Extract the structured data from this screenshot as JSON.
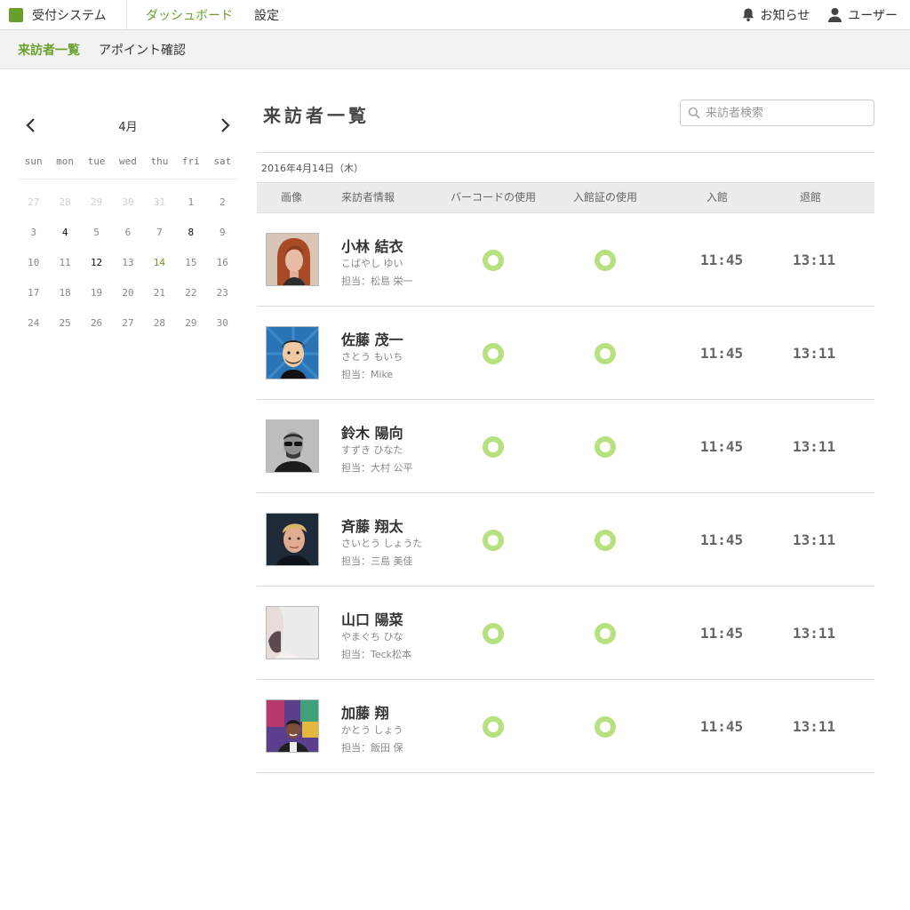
{
  "app": {
    "name": "受付システム",
    "brand_color": "#6a9f2c",
    "nav": [
      "ダッシュボード",
      "設定"
    ],
    "notifications_label": "お知らせ",
    "user_label": "ユーザー"
  },
  "subnav": [
    "来訪者一覧",
    "アポイント確認"
  ],
  "calendar": {
    "month": "4月",
    "weekdays": [
      "sun",
      "mon",
      "tue",
      "wed",
      "thu",
      "fri",
      "sat"
    ],
    "weeks": [
      [
        "27",
        "28",
        "29",
        "30",
        "31",
        "1",
        "2"
      ],
      [
        "3",
        "4",
        "5",
        "6",
        "7",
        "8",
        "9"
      ],
      [
        "10",
        "11",
        "12",
        "13",
        "14",
        "15",
        "16"
      ],
      [
        "17",
        "18",
        "19",
        "20",
        "21",
        "22",
        "23"
      ],
      [
        "24",
        "25",
        "26",
        "27",
        "28",
        "29",
        "30"
      ]
    ],
    "muted_days": [
      "27",
      "28",
      "29",
      "30",
      "31"
    ],
    "highlight_days": [
      "4",
      "8",
      "12"
    ],
    "today": "14"
  },
  "main": {
    "title": "来訪者一覧",
    "search_placeholder": "来訪者検索",
    "date": "2016年4月14日（木）",
    "columns": [
      "画像",
      "来訪者情報",
      "バーコードの使用",
      "入館証の使用",
      "入館",
      "退館"
    ],
    "status_color": "#b7e07f",
    "visitors": [
      {
        "name": "小林 結衣",
        "kana": "こばやし ゆい",
        "staff": "担当：松島 栄一",
        "barcode": true,
        "badge": true,
        "in": "11:45",
        "out": "13:11",
        "avatar": "woman-redhead"
      },
      {
        "name": "佐藤 茂一",
        "kana": "さとう もいち",
        "staff": "担当：Mike",
        "barcode": true,
        "badge": true,
        "in": "11:45",
        "out": "13:11",
        "avatar": "cartoon-man"
      },
      {
        "name": "鈴木 陽向",
        "kana": "すずき ひなた",
        "staff": "担当：大村 公平",
        "barcode": true,
        "badge": true,
        "in": "11:45",
        "out": "13:11",
        "avatar": "man-sunglasses"
      },
      {
        "name": "斉藤 翔太",
        "kana": "さいとう しょうた",
        "staff": "担当：三島 美佳",
        "barcode": true,
        "badge": true,
        "in": "11:45",
        "out": "13:11",
        "avatar": "man-blond"
      },
      {
        "name": "山口 陽菜",
        "kana": "やまぐち ひな",
        "staff": "担当：Teck松本",
        "barcode": true,
        "badge": true,
        "in": "11:45",
        "out": "13:11",
        "avatar": "woman-light"
      },
      {
        "name": "加藤 翔",
        "kana": "かとう しょう",
        "staff": "担当：飯田 保",
        "barcode": true,
        "badge": true,
        "in": "11:45",
        "out": "13:11",
        "avatar": "man-colorful"
      }
    ]
  }
}
